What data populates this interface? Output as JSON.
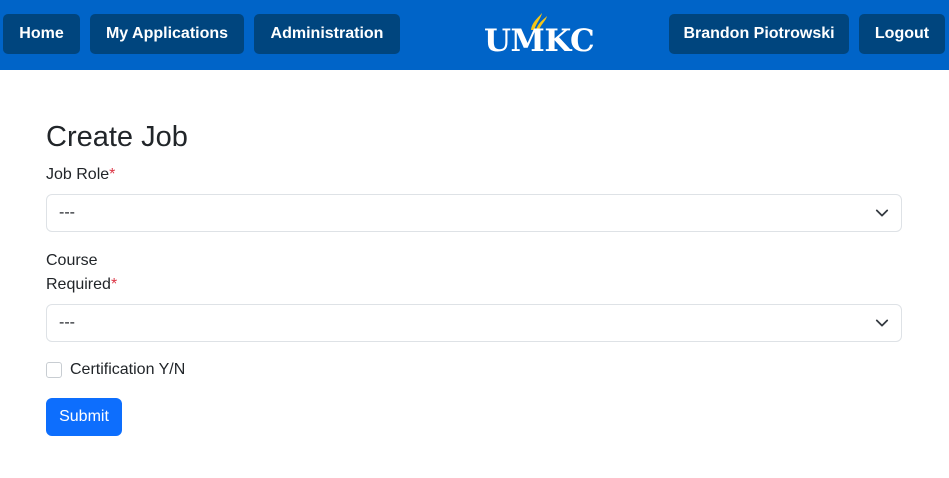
{
  "nav": {
    "home": "Home",
    "my_applications": "My Applications",
    "administration": "Administration",
    "user": "Brandon Piotrowski",
    "logout": "Logout"
  },
  "logo": {
    "text": "UMKC",
    "icon": "umkc-flame-logo-icon",
    "flame_color": "#f5c518"
  },
  "form": {
    "title": "Create Job",
    "job_role": {
      "label": "Job Role",
      "required_mark": "*",
      "value": "---",
      "icon": "chevron-down-icon"
    },
    "course": {
      "label_line1": "Course",
      "label_line2": "Required",
      "required_mark": "*",
      "value": "---",
      "icon": "chevron-down-icon"
    },
    "certification": {
      "label": "Certification Y/N",
      "checked": false
    },
    "submit_label": "Submit"
  },
  "colors": {
    "navbar_bg": "#0064c8",
    "nav_button_bg": "#00457e",
    "primary_button": "#0d6efd",
    "required": "#dc3545"
  }
}
